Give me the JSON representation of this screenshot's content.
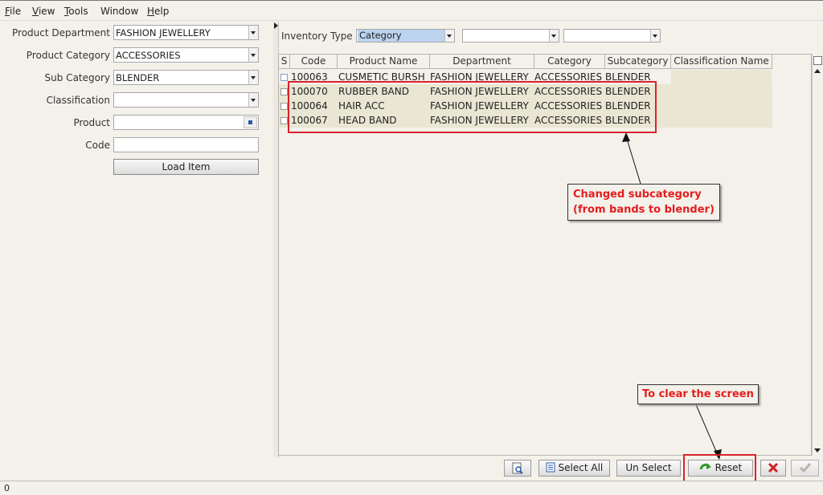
{
  "menu": {
    "items": [
      {
        "label": "File",
        "accel": "F",
        "rest": "ile"
      },
      {
        "label": "View",
        "accel": "V",
        "rest": "iew"
      },
      {
        "label": "Tools",
        "accel": "T",
        "rest": "ools"
      },
      {
        "label": "Window",
        "accel": "",
        "rest": "Window"
      },
      {
        "label": "Help",
        "accel": "H",
        "rest": "elp"
      }
    ]
  },
  "filters": {
    "department_label": "Product Department",
    "department_value": "FASHION JEWELLERY",
    "category_label": "Product Category",
    "category_value": "ACCESSORIES",
    "subcategory_label": "Sub Category",
    "subcategory_value": "BLENDER",
    "classification_label": "Classification",
    "classification_value": "",
    "product_label": "Product",
    "product_value": "",
    "code_label": "Code",
    "code_value": "",
    "load_button": "Load Item"
  },
  "inventory": {
    "label": "Inventory Type",
    "type_value": "Category",
    "second_value": "",
    "third_value": ""
  },
  "table": {
    "columns": [
      "S",
      "Code",
      "Product Name",
      "Department",
      "Category",
      "Subcategory",
      "Classification Name"
    ],
    "rows": [
      {
        "code": "100063",
        "name": "CUSMETIC BURSH",
        "department": "FASHION JEWELLERY",
        "category": "ACCESSORIES",
        "subcategory": "BLENDER",
        "classification": ""
      },
      {
        "code": "100070",
        "name": "RUBBER BAND",
        "department": "FASHION JEWELLERY",
        "category": "ACCESSORIES",
        "subcategory": "BLENDER",
        "classification": ""
      },
      {
        "code": "100064",
        "name": "HAIR ACC",
        "department": "FASHION JEWELLERY",
        "category": "ACCESSORIES",
        "subcategory": "BLENDER",
        "classification": ""
      },
      {
        "code": "100067",
        "name": "HEAD BAND",
        "department": "FASHION JEWELLERY",
        "category": "ACCESSORIES",
        "subcategory": "BLENDER",
        "classification": ""
      }
    ]
  },
  "annotations": {
    "subcategory_line1": "Changed subcategory",
    "subcategory_line2": "(from bands to blender)",
    "reset_note": "To clear the screen",
    "color": "#d9232b"
  },
  "buttons": {
    "select_all": "Select All",
    "select_all_accel": "A",
    "un_select": "Un Select",
    "reset": "Reset"
  },
  "status": {
    "text": "0"
  }
}
